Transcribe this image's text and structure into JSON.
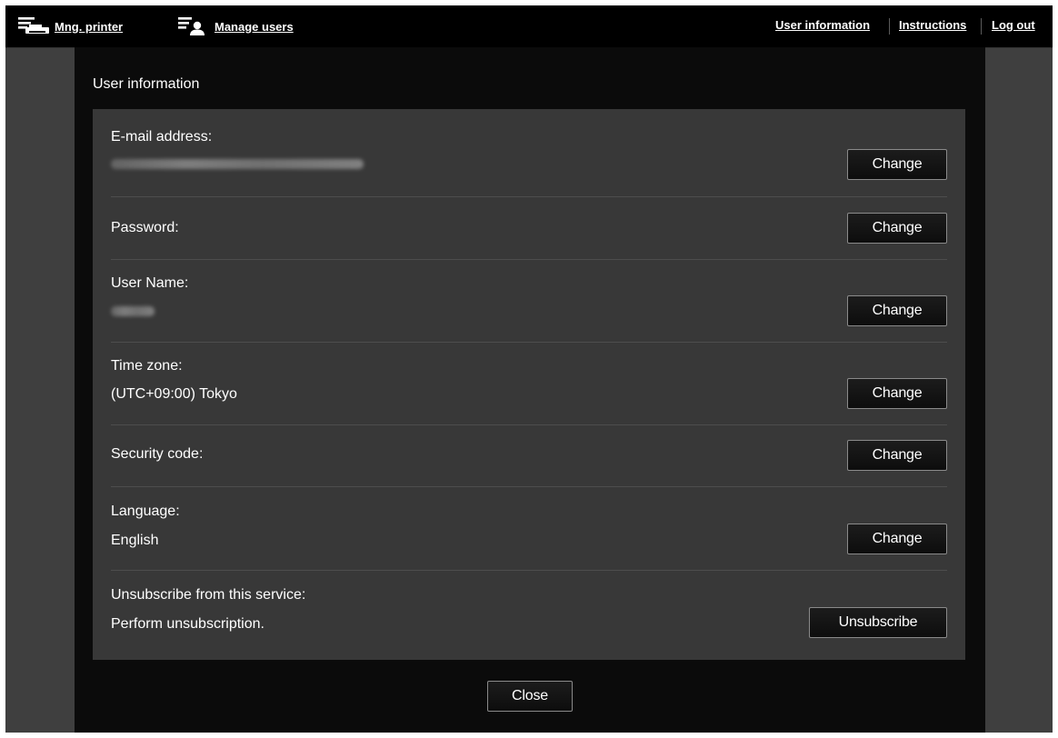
{
  "topbar": {
    "mng_printer": "Mng. printer",
    "manage_users": "Manage users",
    "user_information": "User information",
    "instructions": "Instructions",
    "log_out": "Log out"
  },
  "panel": {
    "title": "User information",
    "close_label": "Close"
  },
  "settings": {
    "email": {
      "label": "E-mail address:",
      "value": "",
      "button": "Change"
    },
    "password": {
      "label": "Password:",
      "button": "Change"
    },
    "user_name": {
      "label": "User Name:",
      "value": "",
      "button": "Change"
    },
    "time_zone": {
      "label": "Time zone:",
      "value": "(UTC+09:00) Tokyo",
      "button": "Change"
    },
    "security_code": {
      "label": "Security code:",
      "button": "Change"
    },
    "language": {
      "label": "Language:",
      "value": "English",
      "button": "Change"
    },
    "unsubscribe": {
      "label": "Unsubscribe from this service:",
      "value": "Perform unsubscription.",
      "button": "Unsubscribe"
    }
  },
  "icons": {
    "printer": "printer-list-icon",
    "users": "user-list-icon"
  },
  "colors": {
    "background": "#3f3f3f",
    "topbar": "#000000",
    "panel": "#0b0b0b",
    "card": "#383838",
    "text": "#ffffff"
  }
}
